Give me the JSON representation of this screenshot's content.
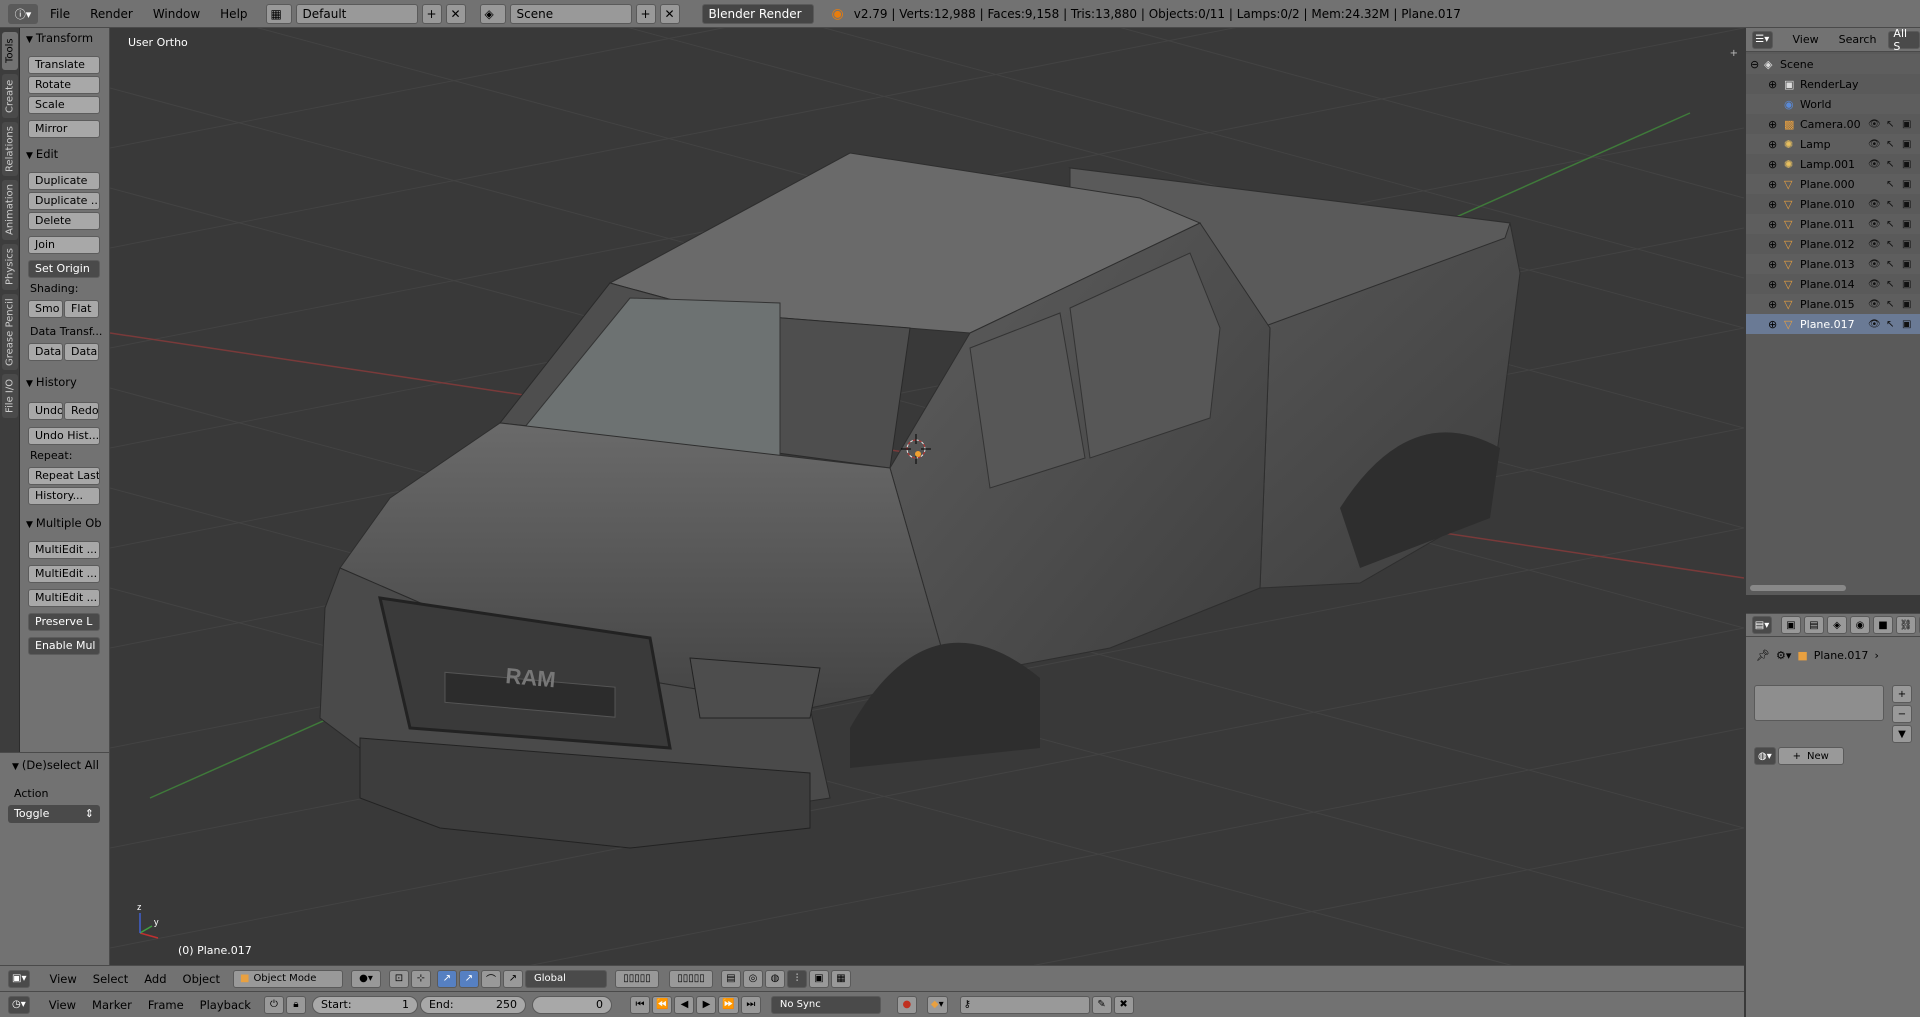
{
  "topbar": {
    "menus": [
      "File",
      "Render",
      "Window",
      "Help"
    ],
    "screen_layout": "Default",
    "scene": "Scene",
    "render_engine": "Blender Render",
    "stats": "v2.79 | Verts:12,988 | Faces:9,158 | Tris:13,880 | Objects:0/11 | Lamps:0/2 | Mem:24.32M | Plane.017"
  },
  "shelf_tabs": [
    "Tools",
    "Create",
    "Relations",
    "Animation",
    "Physics",
    "Grease Pencil",
    "File I/O"
  ],
  "toolshelf": {
    "transform": {
      "title": "Transform",
      "buttons": [
        "Translate",
        "Rotate",
        "Scale",
        "Mirror"
      ]
    },
    "edit": {
      "title": "Edit",
      "buttons": [
        "Duplicate",
        "Duplicate ...",
        "Delete",
        "Join",
        "Set Origin"
      ],
      "shading_label": "Shading:",
      "shading_buttons": [
        "Smo",
        "Flat"
      ],
      "data_transfer_label": "Data Transf...",
      "data_buttons": [
        "Data",
        "Data"
      ]
    },
    "history": {
      "title": "History",
      "undo": "Undo",
      "redo": "Redo",
      "undo_history": "Undo Hist...",
      "repeat_label": "Repeat:",
      "repeat_last": "Repeat Last",
      "history_btn": "History..."
    },
    "multiple": {
      "title": "Multiple Ob",
      "buttons": [
        "MultiEdit ...",
        "MultiEdit ...",
        "MultiEdit ...",
        "Preserve L",
        "Enable Mul"
      ]
    }
  },
  "operator": {
    "title": "(De)select All",
    "action_label": "Action",
    "action_value": "Toggle"
  },
  "viewport": {
    "view_name": "User Ortho",
    "object_label": "(0) Plane.017",
    "grille_text": "RAM"
  },
  "view3d_header": {
    "menus": [
      "View",
      "Select",
      "Add",
      "Object"
    ],
    "mode": "Object Mode",
    "orientation": "Global"
  },
  "timeline_header": {
    "menus": [
      "View",
      "Marker",
      "Frame",
      "Playback"
    ],
    "start_label": "Start:",
    "start_value": "1",
    "end_label": "End:",
    "end_value": "250",
    "current_frame": "0",
    "sync": "No Sync"
  },
  "outliner": {
    "menus": [
      "View",
      "Search",
      "All S"
    ],
    "items": [
      {
        "label": "Scene",
        "icon": "scene-icon"
      },
      {
        "label": "RenderLay",
        "icon": "render-layer-icon"
      },
      {
        "label": "World",
        "icon": "world-icon"
      },
      {
        "label": "Camera.00",
        "icon": "camera-icon"
      },
      {
        "label": "Lamp",
        "icon": "lamp-icon"
      },
      {
        "label": "Lamp.001",
        "icon": "lamp-icon"
      },
      {
        "label": "Plane.000",
        "icon": "mesh-icon"
      },
      {
        "label": "Plane.010",
        "icon": "mesh-icon"
      },
      {
        "label": "Plane.011",
        "icon": "mesh-icon"
      },
      {
        "label": "Plane.012",
        "icon": "mesh-icon"
      },
      {
        "label": "Plane.013",
        "icon": "mesh-icon"
      },
      {
        "label": "Plane.014",
        "icon": "mesh-icon"
      },
      {
        "label": "Plane.015",
        "icon": "mesh-icon"
      },
      {
        "label": "Plane.017",
        "icon": "mesh-icon"
      }
    ]
  },
  "properties": {
    "object_name": "Plane.017",
    "new_button": "New"
  },
  "colors": {
    "accent": "#5680c2",
    "selection": "#f0a030",
    "x_axis": "#a04040",
    "y_axis": "#4a8a40"
  }
}
